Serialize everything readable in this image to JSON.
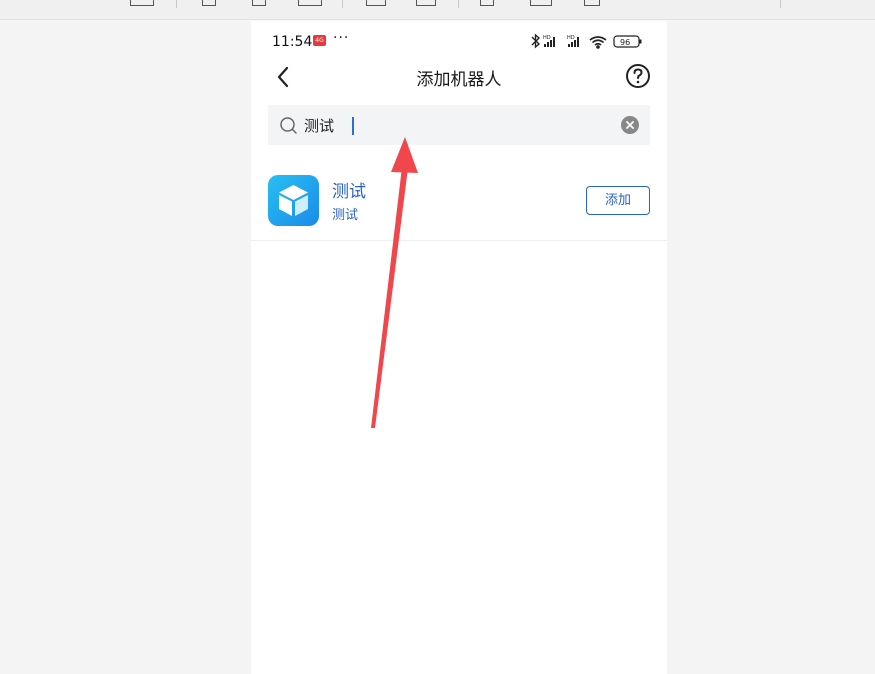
{
  "status_bar": {
    "time": "11:54",
    "badge": "4G",
    "more": "···",
    "battery": "96"
  },
  "nav": {
    "title": "添加机器人"
  },
  "search": {
    "value": "测试",
    "placeholder": ""
  },
  "results": [
    {
      "name": "测试",
      "description": "测试",
      "action_label": "添加"
    }
  ],
  "icons": [
    "back-arrow-icon",
    "help-circle-icon",
    "search-icon",
    "clear-icon",
    "bluetooth-icon",
    "signal-icon",
    "wifi-icon",
    "battery-icon",
    "cube-icon"
  ],
  "colors": {
    "accent": "#2b63c4",
    "avatar": "#1b8be8",
    "annotation_arrow": "#f0474c"
  }
}
